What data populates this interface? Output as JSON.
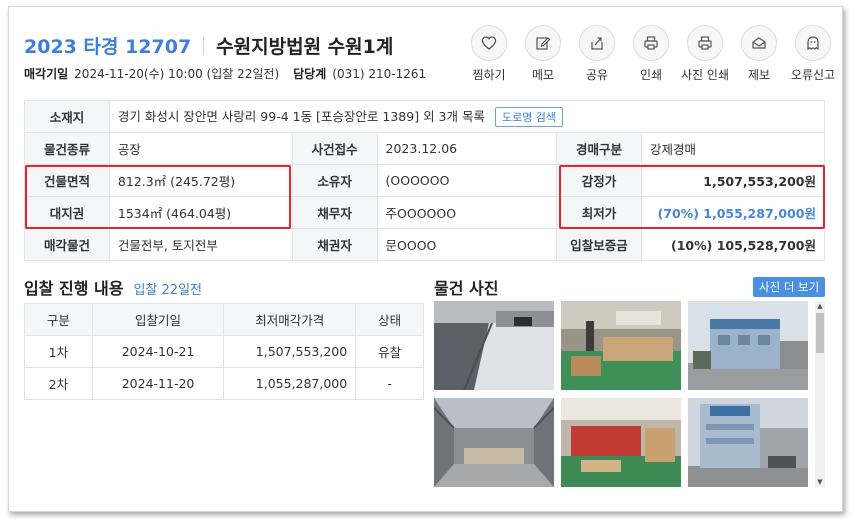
{
  "header": {
    "case_no": "2023 타경 12707",
    "court": "수원지방법원 수원1계",
    "sale_date_label": "매각기일",
    "sale_date": "2024-11-20(수) 10:00 (입찰 22일전)",
    "dept_label": "담당계",
    "dept_phone": "(031) 210-1261"
  },
  "actions": [
    {
      "label": "찜하기",
      "icon": "heart-icon"
    },
    {
      "label": "메모",
      "icon": "pencil-icon"
    },
    {
      "label": "공유",
      "icon": "share-icon"
    },
    {
      "label": "인쇄",
      "icon": "printer-icon"
    },
    {
      "label": "사진 인쇄",
      "icon": "printer-icon"
    },
    {
      "label": "제보",
      "icon": "mail-icon"
    },
    {
      "label": "오류신고",
      "icon": "ghost-icon"
    }
  ],
  "property": {
    "location_label": "소재지",
    "location": "경기 화성시 장안면 사랑리 99-4 1동 [포승장안로 1389] 외 3개 목록",
    "road_btn": "도로명 검색",
    "type_label": "물건종류",
    "type": "공장",
    "filed_label": "사건접수",
    "filed": "2023.12.06",
    "auction_type_label": "경매구분",
    "auction_type": "강제경매",
    "building_area_label": "건물면적",
    "building_area": "812.3㎡ (245.72평)",
    "owner_label": "소유자",
    "owner": "(OOOOOO",
    "appraisal_label": "감정가",
    "appraisal": "1,507,553,200원",
    "land_label": "대지권",
    "land": "1534㎡ (464.04평)",
    "debtor_label": "채무자",
    "debtor": "주OOOOOO",
    "min_price_label": "최저가",
    "min_price": "(70%) 1,055,287,000원",
    "sale_items_label": "매각물건",
    "sale_items": "건물전부, 토지전부",
    "creditor_label": "채권자",
    "creditor": "문OOOO",
    "deposit_label": "입찰보증금",
    "deposit": "(10%) 105,528,700원"
  },
  "bidding": {
    "title": "입찰 진행 내용",
    "subtitle": "입찰 22일전",
    "columns": [
      "구분",
      "입찰기일",
      "최저매각가격",
      "상태"
    ],
    "rows": [
      [
        "1차",
        "2024-10-21",
        "1,507,553,200",
        "유찰"
      ],
      [
        "2차",
        "2024-11-20",
        "1,055,287,000",
        "-"
      ]
    ]
  },
  "photos": {
    "title": "물건 사진",
    "more_btn": "사진 더 보기"
  },
  "colors": {
    "accent": "#3f7fd6",
    "highlight_border": "#e3262e",
    "button_bg": "#4a90e2"
  }
}
